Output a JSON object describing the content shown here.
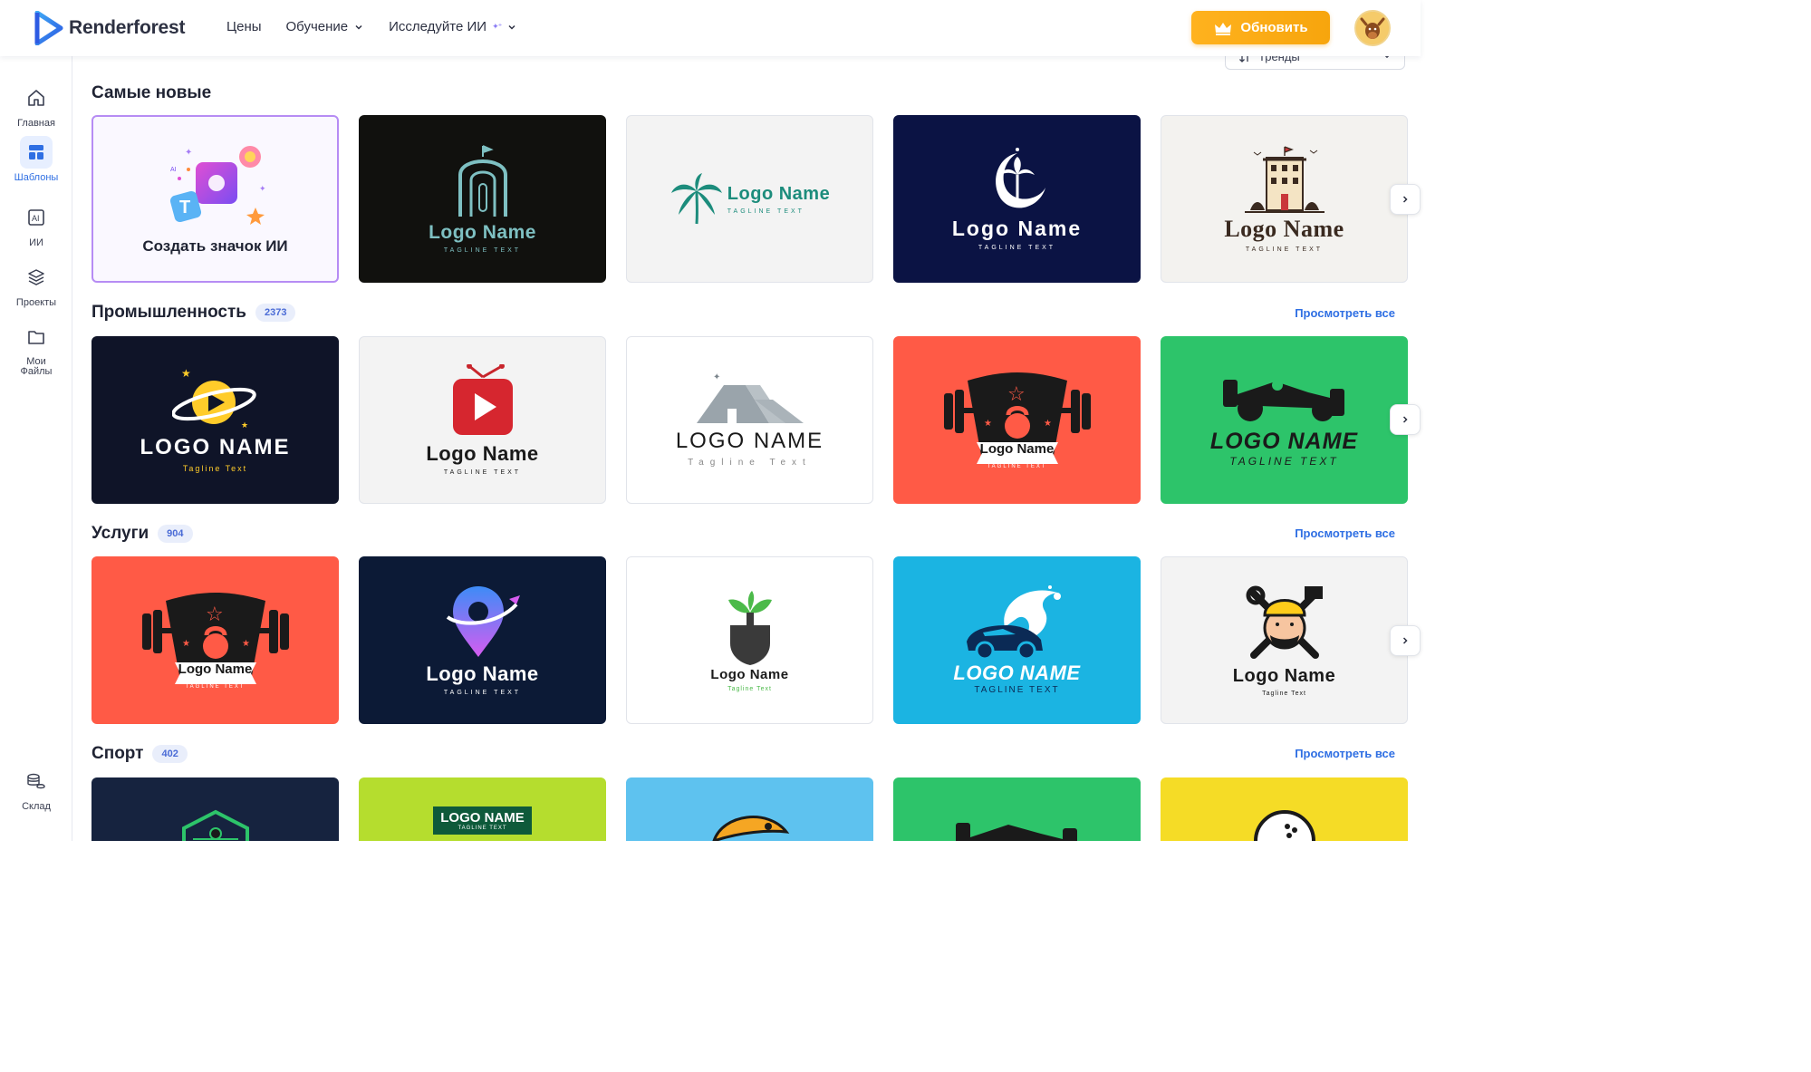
{
  "brand": {
    "name": "Renderforest"
  },
  "nav": {
    "items": [
      "Цены",
      "Обучение",
      "Исследуйте ИИ"
    ]
  },
  "header": {
    "upgrade_label": "Обновить"
  },
  "sidebar": {
    "items": [
      {
        "label": "Главная",
        "icon": "home-icon"
      },
      {
        "label": "Шаблоны",
        "icon": "templates-icon"
      },
      {
        "label": "ИИ",
        "icon": "ai-icon"
      },
      {
        "label": "Проекты",
        "icon": "layers-icon"
      },
      {
        "label": "Мои Файлы",
        "icon": "folder-icon"
      },
      {
        "label": "Склад",
        "icon": "stock-icon"
      }
    ]
  },
  "sort": {
    "label": "Тренды"
  },
  "sections": [
    {
      "title": "Самые новые",
      "ai_card_label": "Создать значок ИИ",
      "cards": [
        {
          "name": "Logo Name",
          "tagline": "Tagline Text"
        },
        {
          "name": "Logo Name",
          "tagline": "Tagline Text"
        },
        {
          "name": "Logo Name",
          "tagline": "Tagline Text"
        },
        {
          "name": "Logo Name",
          "tagline": "Tagline Text"
        }
      ]
    },
    {
      "title": "Промышленность",
      "count": "2373",
      "view_all": "Просмотреть все",
      "cards": [
        {
          "name": "LOGO NAME",
          "tagline": "Tagline Text"
        },
        {
          "name": "Logo Name",
          "tagline": "Tagline Text"
        },
        {
          "name": "LOGO NAME",
          "tagline": "Tagline Text"
        },
        {
          "name": "Logo Name",
          "tagline": "Tagline Text"
        },
        {
          "name": "LOGO NAME",
          "tagline": "Tagline Text"
        }
      ]
    },
    {
      "title": "Услуги",
      "count": "904",
      "view_all": "Просмотреть все",
      "cards": [
        {
          "name": "Logo Name",
          "tagline": "Tagline Text"
        },
        {
          "name": "Logo Name",
          "tagline": "Tagline Text"
        },
        {
          "name": "Logo Name",
          "tagline": "Tagline Text"
        },
        {
          "name": "LOGO NAME",
          "tagline": "Tagline Text"
        },
        {
          "name": "Logo Name",
          "tagline": "Tagline Text"
        }
      ]
    },
    {
      "title": "Спорт",
      "count": "402",
      "view_all": "Просмотреть все",
      "cards": [
        {
          "name": "LOGO NAME",
          "tagline": "Tagline Text"
        }
      ]
    }
  ],
  "colors": {
    "accent": "#2f6fe3",
    "upgrade": "#ffae1a",
    "ai_border": "#b68cf4"
  }
}
